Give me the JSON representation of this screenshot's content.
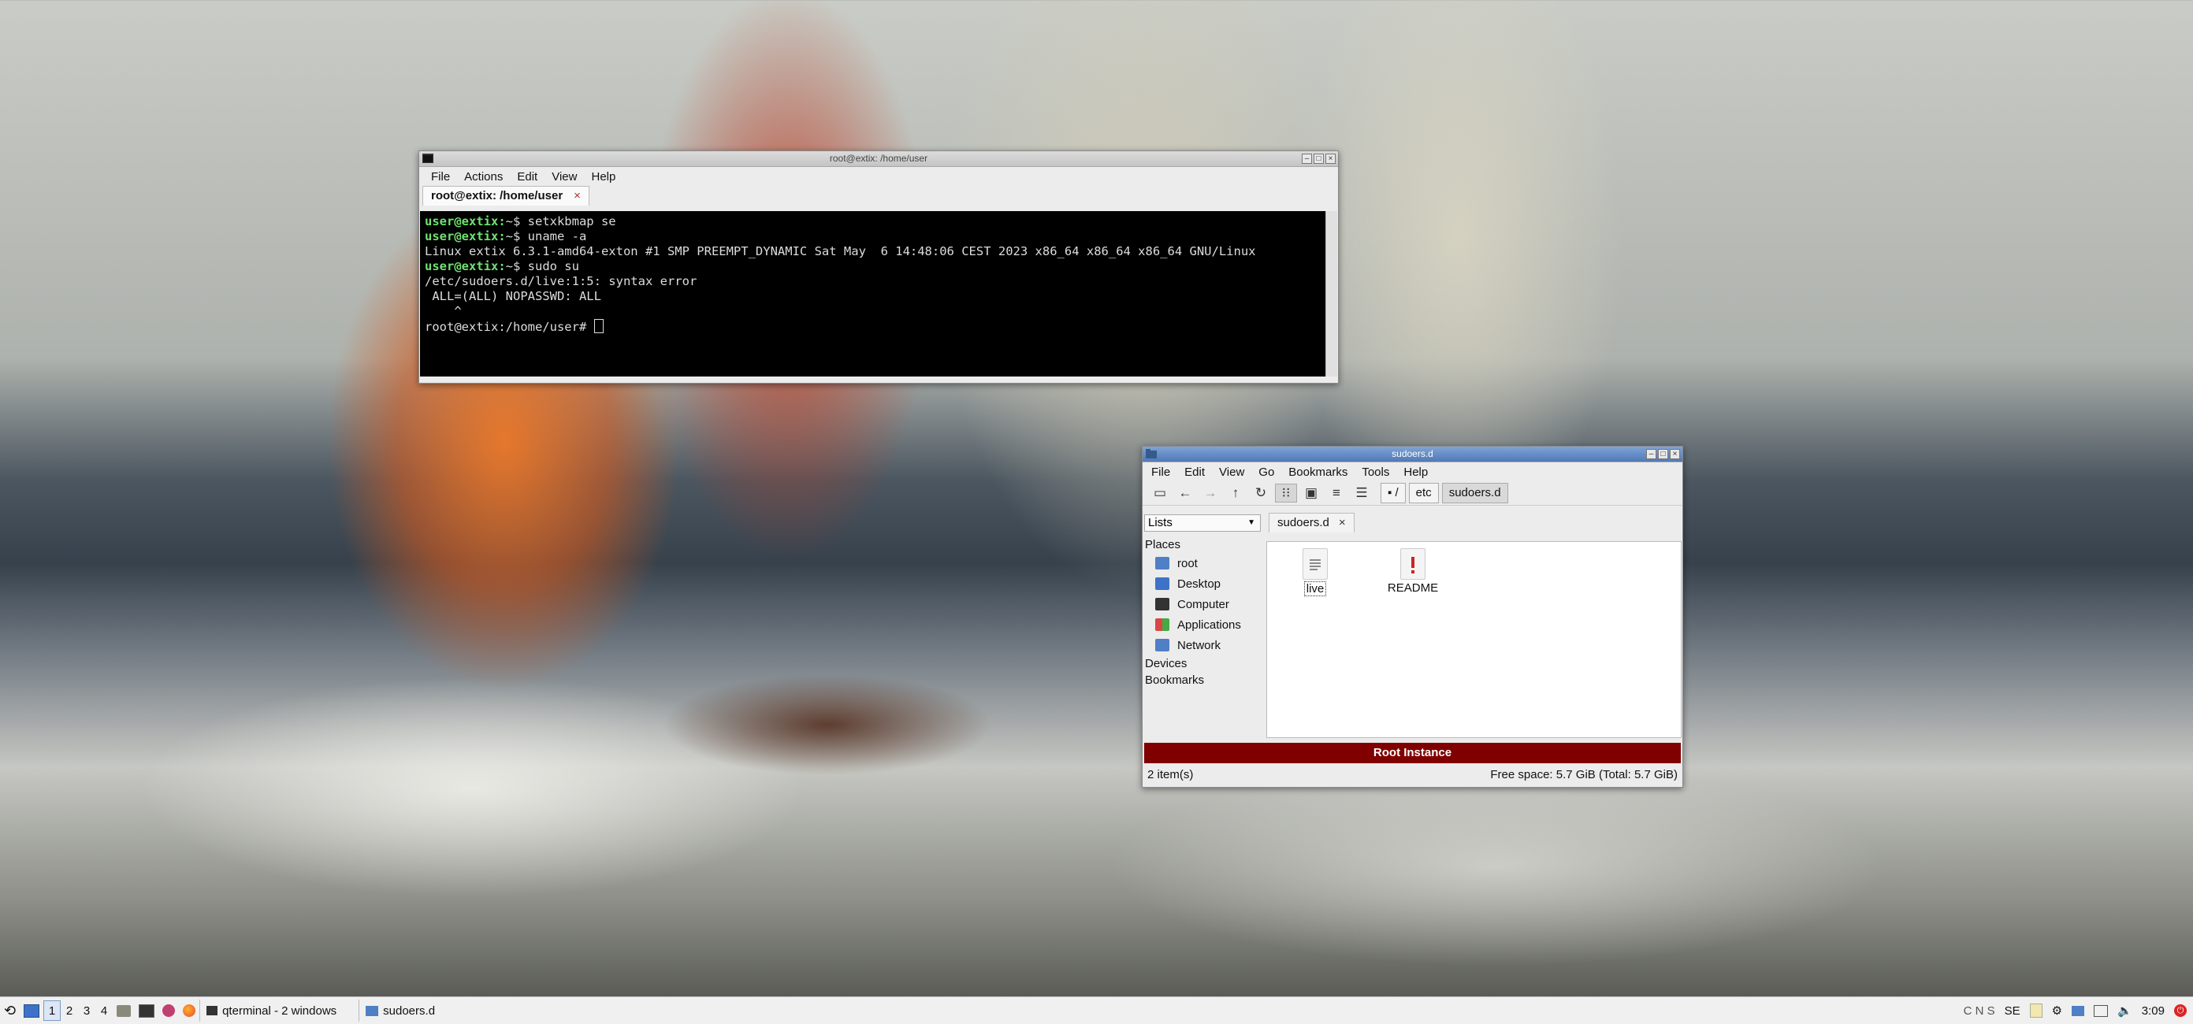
{
  "terminal": {
    "title": "root@extix: /home/user",
    "menu": [
      "File",
      "Actions",
      "Edit",
      "View",
      "Help"
    ],
    "tab_label": "root@extix: /home/user",
    "tab_close": "×",
    "lines": [
      {
        "prompt": "user@extix:",
        "rest": "~$ setxkbmap se"
      },
      {
        "prompt": "user@extix:",
        "rest": "~$ uname -a"
      },
      {
        "prompt": "",
        "rest": "Linux extix 6.3.1-amd64-exton #1 SMP PREEMPT_DYNAMIC Sat May  6 14:48:06 CEST 2023 x86_64 x86_64 x86_64 GNU/Linux"
      },
      {
        "prompt": "user@extix:",
        "rest": "~$ sudo su"
      },
      {
        "prompt": "",
        "rest": "/etc/sudoers.d/live:1:5: syntax error"
      },
      {
        "prompt": "",
        "rest": " ALL=(ALL) NOPASSWD: ALL"
      },
      {
        "prompt": "",
        "rest": "    ^"
      },
      {
        "prompt": "",
        "rest": "root@extix:/home/user# "
      }
    ]
  },
  "filemanager": {
    "title": "sudoers.d",
    "menu": [
      "File",
      "Edit",
      "View",
      "Go",
      "Bookmarks",
      "Tools",
      "Help"
    ],
    "path": [
      "/",
      "etc",
      "sudoers.d"
    ],
    "side_mode": "Lists",
    "places_header": "Places",
    "places": [
      "root",
      "Desktop",
      "Computer",
      "Applications",
      "Network"
    ],
    "devices_header": "Devices",
    "bookmarks_header": "Bookmarks",
    "tab_label": "sudoers.d",
    "tab_close": "×",
    "files": [
      {
        "name": "live",
        "icon": "text-file-icon"
      },
      {
        "name": "README",
        "icon": "readme-warning-icon"
      }
    ],
    "root_banner": "Root Instance",
    "status_count": "2 item(s)",
    "status_free": "Free space: 5.7 GiB (Total: 5.7 GiB)"
  },
  "panel": {
    "workspaces": [
      "1",
      "2",
      "3",
      "4"
    ],
    "tasks": [
      "qterminal - 2 windows",
      "sudoers.d"
    ],
    "keyboard_indicators": "C N S",
    "layout": "SE",
    "clock": "3:09"
  }
}
